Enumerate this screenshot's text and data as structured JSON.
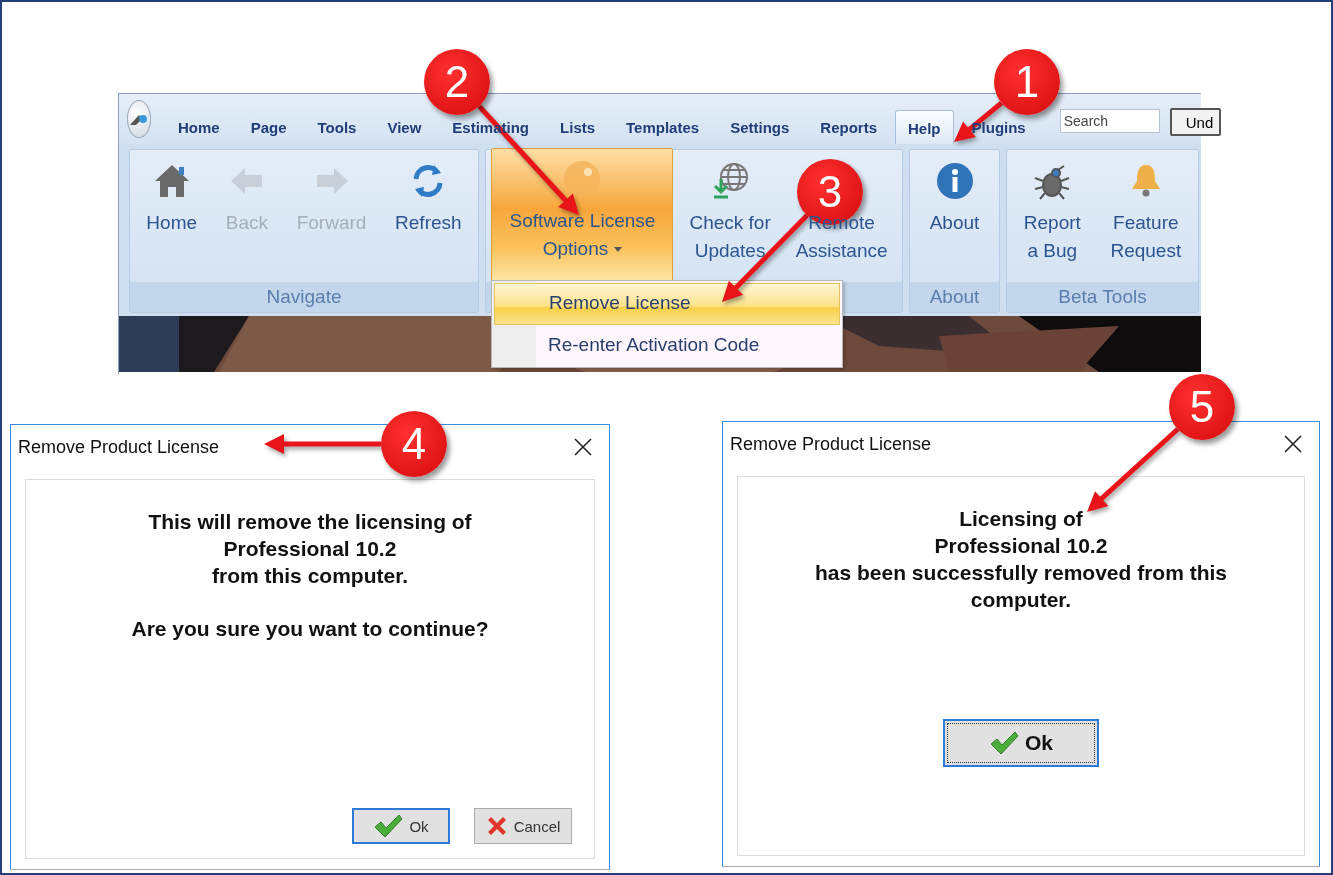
{
  "ribbon": {
    "tabs": [
      {
        "label": "Home",
        "selected": false
      },
      {
        "label": "Page",
        "selected": false
      },
      {
        "label": "Tools",
        "selected": false
      },
      {
        "label": "View",
        "selected": false
      },
      {
        "label": "Estimating",
        "selected": false
      },
      {
        "label": "Lists",
        "selected": false
      },
      {
        "label": "Templates",
        "selected": false
      },
      {
        "label": "Settings",
        "selected": false
      },
      {
        "label": "Reports",
        "selected": false
      },
      {
        "label": "Help",
        "selected": true
      },
      {
        "label": "Plugins",
        "selected": false
      }
    ],
    "search": {
      "placeholder": "Search"
    },
    "cut_button": "Und",
    "groups": [
      {
        "label": "Navigate",
        "buttons": [
          {
            "label": "Home",
            "kind": "home",
            "disabled": false,
            "pressed": false
          },
          {
            "label": "Back",
            "kind": "back",
            "disabled": true,
            "pressed": false
          },
          {
            "label": "Forward",
            "kind": "forward",
            "disabled": true,
            "pressed": false
          },
          {
            "label": "Refresh",
            "kind": "refresh",
            "disabled": false,
            "pressed": false
          }
        ]
      },
      {
        "buttons": [
          {
            "label": "Software License\nOptions",
            "kind": "key",
            "disabled": false,
            "pressed": true,
            "dropdown": true
          },
          {
            "label": "Check for\nUpdates",
            "kind": "globe",
            "disabled": false,
            "pressed": false
          },
          {
            "label": "Remote\nAssistance",
            "kind": "plain",
            "disabled": false,
            "pressed": false
          }
        ]
      },
      {
        "label": "About",
        "buttons": [
          {
            "label": "About",
            "kind": "info",
            "disabled": false,
            "pressed": false
          }
        ]
      },
      {
        "label": "Beta Tools",
        "buttons": [
          {
            "label": "Report\na Bug",
            "kind": "bug",
            "disabled": false,
            "pressed": false
          },
          {
            "label": "Feature\nRequest",
            "kind": "bell",
            "disabled": false,
            "pressed": false
          }
        ]
      }
    ],
    "menu": {
      "items": [
        {
          "label": "Remove License",
          "selected": true
        },
        {
          "label": "Re-enter Activation Code",
          "selected": false
        }
      ]
    }
  },
  "dialogs": [
    {
      "title": "Remove Product License",
      "paragraphs": [
        "This will remove the licensing of\nProfessional 10.2\nfrom this computer.",
        "Are you sure you want to continue?"
      ],
      "buttons": [
        {
          "label": "Ok",
          "kind": "ok",
          "focused": true
        },
        {
          "label": "Cancel",
          "kind": "cancel",
          "focused": false
        }
      ]
    },
    {
      "title": "Remove Product License",
      "paragraphs": [
        "Licensing of\nProfessional 10.2\nhas been successfully removed from this\ncomputer."
      ],
      "buttons": [
        {
          "label": "Ok",
          "kind": "ok",
          "focused": true
        }
      ]
    }
  ],
  "callouts": [
    {
      "number": "1"
    },
    {
      "number": "2"
    },
    {
      "number": "3"
    },
    {
      "number": "4"
    },
    {
      "number": "5"
    }
  ]
}
